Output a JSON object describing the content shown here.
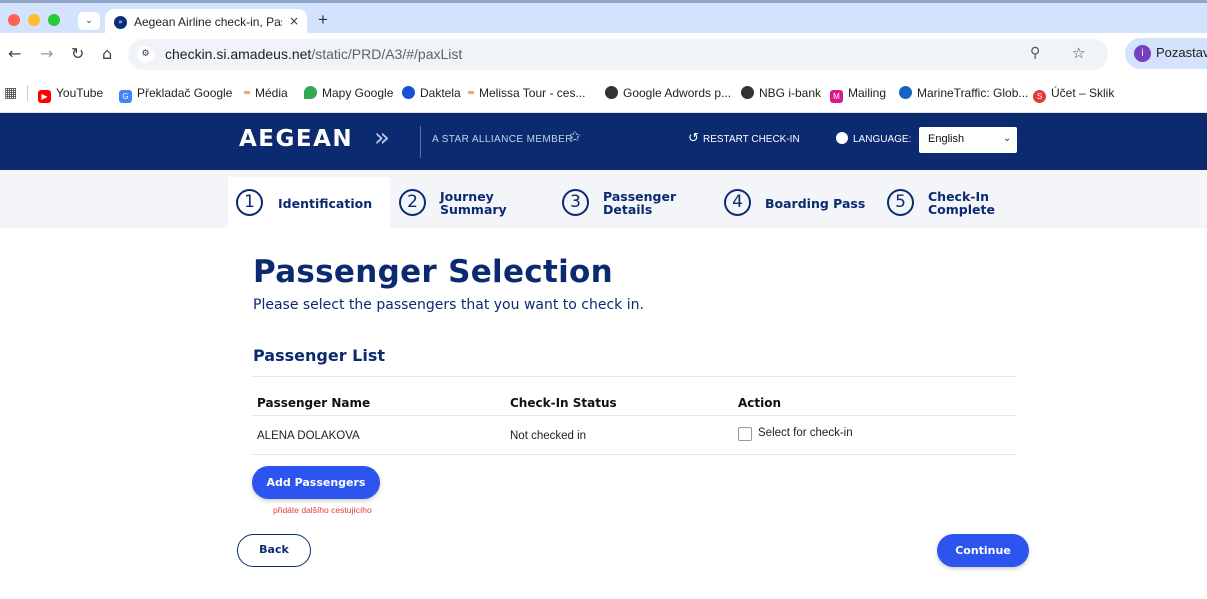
{
  "browser": {
    "traffic_colors": [
      "#ff5f57",
      "#febc2e",
      "#28c840"
    ],
    "tab_title": "Aegean Airline check-in, Pass",
    "tab_close": "×",
    "new_tab": "+",
    "url_host": "checkin.si.amadeus.net",
    "url_path": "/static/PRD/A3/#/paxList",
    "profile_initial": "i",
    "profile_label": "Pozastave",
    "nav_icons": [
      "back-icon",
      "forward-icon",
      "reload-icon",
      "home-icon"
    ],
    "bookmarks": [
      {
        "label": "YouTube",
        "icon_color": "#ff0000"
      },
      {
        "label": "Překladač Google",
        "icon_color": "#4285f4"
      },
      {
        "label": "Média",
        "icon_color": "#f4a261"
      },
      {
        "label": "Mapy Google",
        "icon_color": "#34a853"
      },
      {
        "label": "Daktela",
        "icon_color": "#1a4fd8"
      },
      {
        "label": "Melissa Tour - ces...",
        "icon_color": "#f4a261"
      },
      {
        "label": "Google Adwords p...",
        "icon_color": "#333333"
      },
      {
        "label": "NBG i-bank",
        "icon_color": "#333333"
      },
      {
        "label": "Mailing",
        "icon_color": "#d81b8c"
      },
      {
        "label": "MarineTraffic: Glob...",
        "icon_color": "#1565c0"
      },
      {
        "label": "Účet – Sklik",
        "icon_color": "#e53935"
      }
    ]
  },
  "header": {
    "logo": "AEGEAN",
    "alliance": "A STAR ALLIANCE MEMBER",
    "restart": "RESTART CHECK-IN",
    "language_label": "LANGUAGE:",
    "language_value": "English",
    "brand_color": "#0b2a6f"
  },
  "steps": [
    {
      "number": "1",
      "line1": "Identification",
      "line2": ""
    },
    {
      "number": "2",
      "line1": "Journey",
      "line2": "Summary"
    },
    {
      "number": "3",
      "line1": "Passenger",
      "line2": "Details"
    },
    {
      "number": "4",
      "line1": "Boarding Pass",
      "line2": ""
    },
    {
      "number": "5",
      "line1": "Check-In",
      "line2": "Complete"
    }
  ],
  "main": {
    "title": "Passenger Selection",
    "subtitle": "Please select the passengers that you want to check in.",
    "list_heading": "Passenger List",
    "columns": [
      "Passenger Name",
      "Check-In Status",
      "Action"
    ],
    "rows": [
      {
        "name": "ALENA DOLAKOVA",
        "status": "Not checked in",
        "action": "Select for check-in",
        "selected": false
      }
    ],
    "add_button": "Add Passengers",
    "annotation": "přidáte dalšího cestujícího",
    "back_button": "Back",
    "continue_button": "Continue",
    "accent_color": "#2c55f0"
  }
}
